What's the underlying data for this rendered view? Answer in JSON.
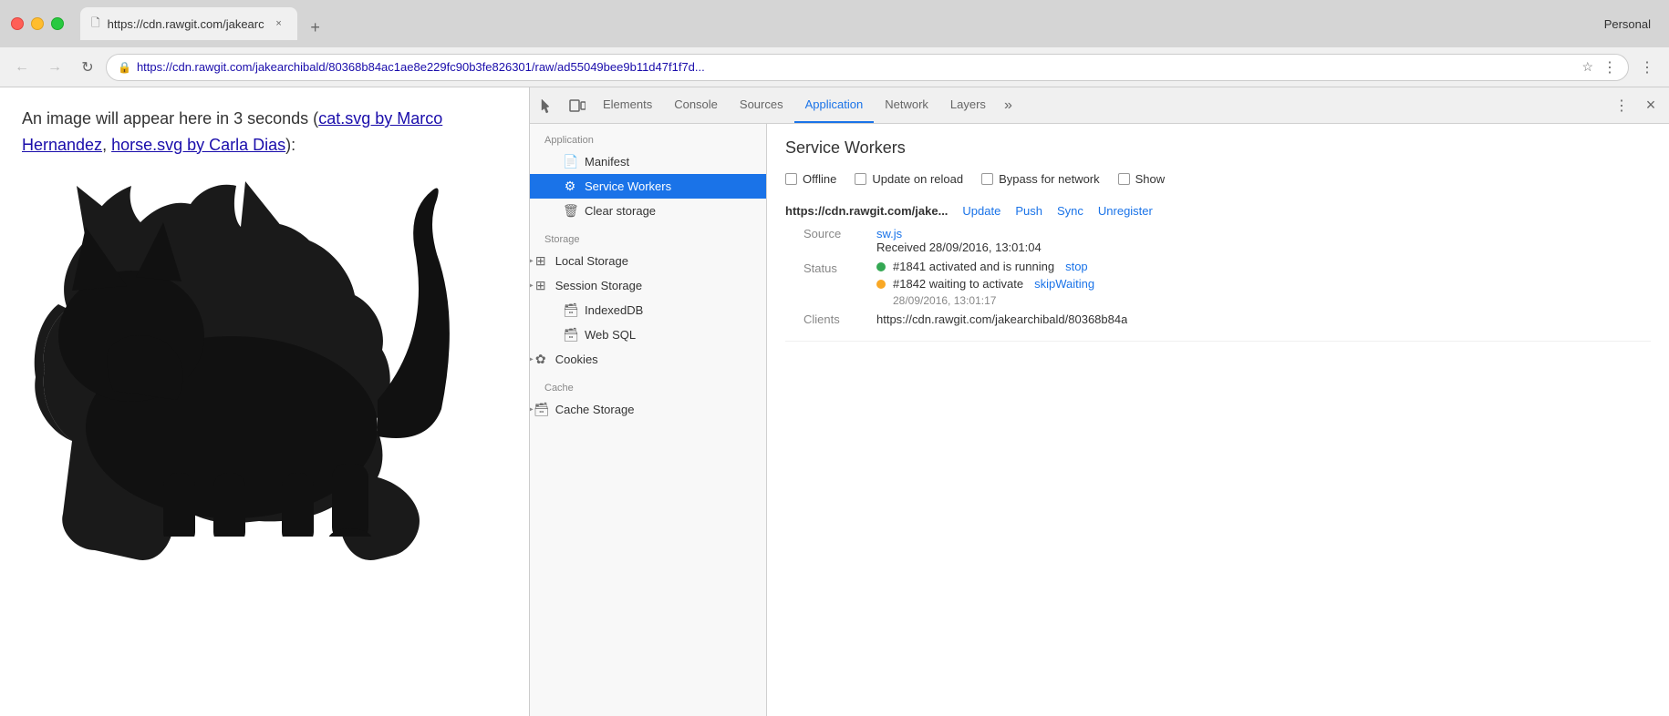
{
  "browser": {
    "profile": "Personal",
    "tab": {
      "title": "https://cdn.rawgit.com/jakearc",
      "url_display": "https://cdn.rawgit.com/jakearchibald/80368b84ac1ae8e229fc90b3fe826301/raw/ad55049bee9b11d47f1f7d...",
      "url_full": "https://cdn.rawgit.com/jakearchibald/80368b84ac1ae8e229fc90b3fe826301/raw/ad55049bee9b11d47f1f7d...",
      "close_label": "×"
    }
  },
  "page": {
    "text_prefix": "An image will appear here in 3 seconds (",
    "link1_text": "cat.svg by Marco Hernandez",
    "link2_text": "horse.svg by Carla Dias",
    "text_suffix": "):"
  },
  "devtools": {
    "tabs": [
      {
        "label": "Elements",
        "active": false
      },
      {
        "label": "Console",
        "active": false
      },
      {
        "label": "Sources",
        "active": false
      },
      {
        "label": "Application",
        "active": true
      },
      {
        "label": "Network",
        "active": false
      },
      {
        "label": "Layers",
        "active": false
      }
    ],
    "more_label": "»",
    "close_label": "×"
  },
  "sidebar": {
    "application_header": "Application",
    "items_application": [
      {
        "label": "Manifest",
        "icon": "📄",
        "active": false,
        "arrow": false
      },
      {
        "label": "Service Workers",
        "icon": "⚙",
        "active": true,
        "arrow": false
      },
      {
        "label": "Clear storage",
        "icon": "🗑",
        "active": false,
        "arrow": false
      }
    ],
    "storage_header": "Storage",
    "items_storage": [
      {
        "label": "Local Storage",
        "icon": "▦",
        "active": false,
        "arrow": true
      },
      {
        "label": "Session Storage",
        "icon": "▦",
        "active": false,
        "arrow": true
      },
      {
        "label": "IndexedDB",
        "icon": "🗃",
        "active": false,
        "arrow": false
      },
      {
        "label": "Web SQL",
        "icon": "🗃",
        "active": false,
        "arrow": false
      },
      {
        "label": "Cookies",
        "icon": "✿",
        "active": false,
        "arrow": true
      }
    ],
    "cache_header": "Cache",
    "items_cache": [
      {
        "label": "Cache Storage",
        "icon": "🗃",
        "active": false,
        "arrow": true
      }
    ]
  },
  "panel": {
    "title": "Service Workers",
    "checkboxes": [
      {
        "label": "Offline",
        "checked": false
      },
      {
        "label": "Update on reload",
        "checked": false
      },
      {
        "label": "Bypass for network",
        "checked": false
      },
      {
        "label": "Show",
        "checked": false
      }
    ],
    "sw_url": "https://cdn.rawgit.com/jake...",
    "sw_actions": [
      "Update",
      "Push",
      "Sync",
      "Unregister"
    ],
    "source_label": "Source",
    "source_file": "sw.js",
    "received_text": "Received 28/09/2016, 13:01:04",
    "status_label": "Status",
    "status1_text": "#1841 activated and is running",
    "status1_action": "stop",
    "status2_text": "#1842 waiting to activate",
    "status2_action": "skipWaiting",
    "status2_date": "28/09/2016, 13:01:17",
    "clients_label": "Clients",
    "clients_value": "https://cdn.rawgit.com/jakearchibald/80368b84a"
  }
}
